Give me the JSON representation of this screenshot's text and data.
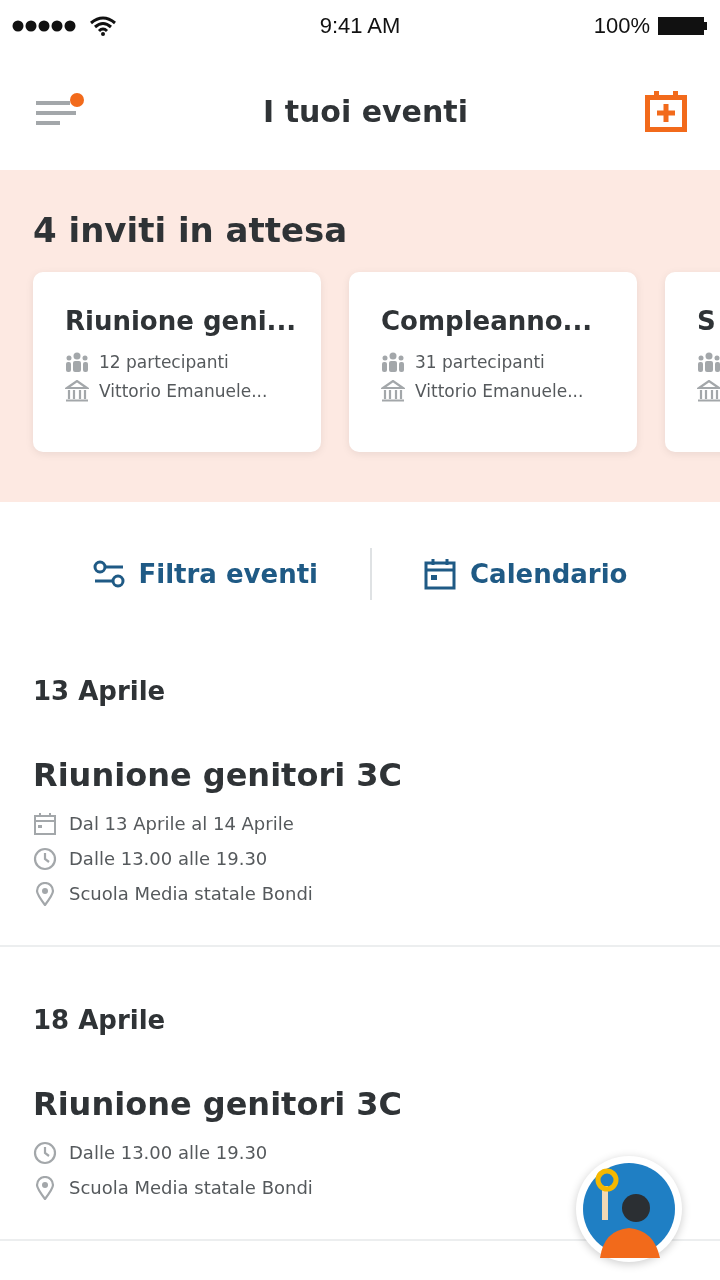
{
  "status_bar": {
    "time": "9:41 AM",
    "battery": "100%"
  },
  "header": {
    "title": "I tuoi eventi",
    "menu_notification": true
  },
  "invites": {
    "title": "4 inviti in attesa",
    "cards": [
      {
        "title": "Riunione geni...",
        "participants": "12 partecipanti",
        "place": "Vittorio Emanuele..."
      },
      {
        "title": "Compleanno...",
        "participants": "31 partecipanti",
        "place": "Vittorio Emanuele..."
      },
      {
        "title": "S"
      }
    ]
  },
  "actions": [
    {
      "kind": "filter",
      "label": "Filtra eventi"
    },
    {
      "kind": "calendar",
      "label": "Calendario"
    }
  ],
  "events": [
    {
      "date": "13 Aprile",
      "title": "Riunione genitori 3C",
      "details": [
        {
          "kind": "date",
          "text": "Dal 13 Aprile al 14 Aprile"
        },
        {
          "kind": "time",
          "text": "Dalle 13.00 alle 19.30"
        },
        {
          "kind": "place",
          "text": "Scuola Media statale Bondi"
        }
      ]
    },
    {
      "date": "18 Aprile",
      "title": "Riunione genitori 3C",
      "details": [
        {
          "kind": "time",
          "text": "Dalle 13.00 alle 19.30"
        },
        {
          "kind": "place",
          "text": "Scuola Media statale Bondi"
        }
      ]
    }
  ]
}
